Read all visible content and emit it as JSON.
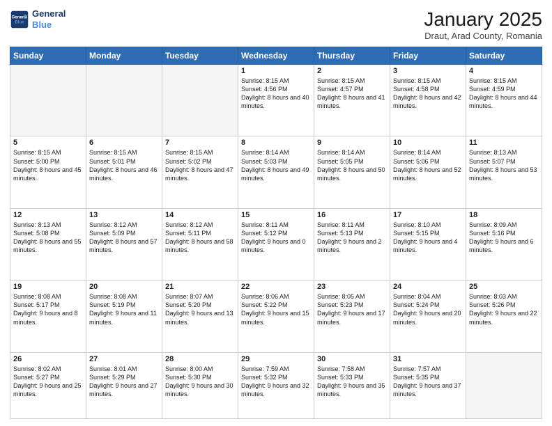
{
  "header": {
    "logo_line1": "General",
    "logo_line2": "Blue",
    "month_title": "January 2025",
    "location": "Draut, Arad County, Romania"
  },
  "days_of_week": [
    "Sunday",
    "Monday",
    "Tuesday",
    "Wednesday",
    "Thursday",
    "Friday",
    "Saturday"
  ],
  "weeks": [
    [
      {
        "num": "",
        "info": ""
      },
      {
        "num": "",
        "info": ""
      },
      {
        "num": "",
        "info": ""
      },
      {
        "num": "1",
        "info": "Sunrise: 8:15 AM\nSunset: 4:56 PM\nDaylight: 8 hours\nand 40 minutes."
      },
      {
        "num": "2",
        "info": "Sunrise: 8:15 AM\nSunset: 4:57 PM\nDaylight: 8 hours\nand 41 minutes."
      },
      {
        "num": "3",
        "info": "Sunrise: 8:15 AM\nSunset: 4:58 PM\nDaylight: 8 hours\nand 42 minutes."
      },
      {
        "num": "4",
        "info": "Sunrise: 8:15 AM\nSunset: 4:59 PM\nDaylight: 8 hours\nand 44 minutes."
      }
    ],
    [
      {
        "num": "5",
        "info": "Sunrise: 8:15 AM\nSunset: 5:00 PM\nDaylight: 8 hours\nand 45 minutes."
      },
      {
        "num": "6",
        "info": "Sunrise: 8:15 AM\nSunset: 5:01 PM\nDaylight: 8 hours\nand 46 minutes."
      },
      {
        "num": "7",
        "info": "Sunrise: 8:15 AM\nSunset: 5:02 PM\nDaylight: 8 hours\nand 47 minutes."
      },
      {
        "num": "8",
        "info": "Sunrise: 8:14 AM\nSunset: 5:03 PM\nDaylight: 8 hours\nand 49 minutes."
      },
      {
        "num": "9",
        "info": "Sunrise: 8:14 AM\nSunset: 5:05 PM\nDaylight: 8 hours\nand 50 minutes."
      },
      {
        "num": "10",
        "info": "Sunrise: 8:14 AM\nSunset: 5:06 PM\nDaylight: 8 hours\nand 52 minutes."
      },
      {
        "num": "11",
        "info": "Sunrise: 8:13 AM\nSunset: 5:07 PM\nDaylight: 8 hours\nand 53 minutes."
      }
    ],
    [
      {
        "num": "12",
        "info": "Sunrise: 8:13 AM\nSunset: 5:08 PM\nDaylight: 8 hours\nand 55 minutes."
      },
      {
        "num": "13",
        "info": "Sunrise: 8:12 AM\nSunset: 5:09 PM\nDaylight: 8 hours\nand 57 minutes."
      },
      {
        "num": "14",
        "info": "Sunrise: 8:12 AM\nSunset: 5:11 PM\nDaylight: 8 hours\nand 58 minutes."
      },
      {
        "num": "15",
        "info": "Sunrise: 8:11 AM\nSunset: 5:12 PM\nDaylight: 9 hours\nand 0 minutes."
      },
      {
        "num": "16",
        "info": "Sunrise: 8:11 AM\nSunset: 5:13 PM\nDaylight: 9 hours\nand 2 minutes."
      },
      {
        "num": "17",
        "info": "Sunrise: 8:10 AM\nSunset: 5:15 PM\nDaylight: 9 hours\nand 4 minutes."
      },
      {
        "num": "18",
        "info": "Sunrise: 8:09 AM\nSunset: 5:16 PM\nDaylight: 9 hours\nand 6 minutes."
      }
    ],
    [
      {
        "num": "19",
        "info": "Sunrise: 8:08 AM\nSunset: 5:17 PM\nDaylight: 9 hours\nand 8 minutes."
      },
      {
        "num": "20",
        "info": "Sunrise: 8:08 AM\nSunset: 5:19 PM\nDaylight: 9 hours\nand 11 minutes."
      },
      {
        "num": "21",
        "info": "Sunrise: 8:07 AM\nSunset: 5:20 PM\nDaylight: 9 hours\nand 13 minutes."
      },
      {
        "num": "22",
        "info": "Sunrise: 8:06 AM\nSunset: 5:22 PM\nDaylight: 9 hours\nand 15 minutes."
      },
      {
        "num": "23",
        "info": "Sunrise: 8:05 AM\nSunset: 5:23 PM\nDaylight: 9 hours\nand 17 minutes."
      },
      {
        "num": "24",
        "info": "Sunrise: 8:04 AM\nSunset: 5:24 PM\nDaylight: 9 hours\nand 20 minutes."
      },
      {
        "num": "25",
        "info": "Sunrise: 8:03 AM\nSunset: 5:26 PM\nDaylight: 9 hours\nand 22 minutes."
      }
    ],
    [
      {
        "num": "26",
        "info": "Sunrise: 8:02 AM\nSunset: 5:27 PM\nDaylight: 9 hours\nand 25 minutes."
      },
      {
        "num": "27",
        "info": "Sunrise: 8:01 AM\nSunset: 5:29 PM\nDaylight: 9 hours\nand 27 minutes."
      },
      {
        "num": "28",
        "info": "Sunrise: 8:00 AM\nSunset: 5:30 PM\nDaylight: 9 hours\nand 30 minutes."
      },
      {
        "num": "29",
        "info": "Sunrise: 7:59 AM\nSunset: 5:32 PM\nDaylight: 9 hours\nand 32 minutes."
      },
      {
        "num": "30",
        "info": "Sunrise: 7:58 AM\nSunset: 5:33 PM\nDaylight: 9 hours\nand 35 minutes."
      },
      {
        "num": "31",
        "info": "Sunrise: 7:57 AM\nSunset: 5:35 PM\nDaylight: 9 hours\nand 37 minutes."
      },
      {
        "num": "",
        "info": ""
      }
    ]
  ]
}
